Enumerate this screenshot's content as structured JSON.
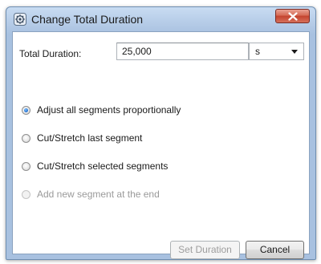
{
  "window": {
    "title": "Change Total Duration",
    "icon": "app-gear-icon"
  },
  "duration": {
    "label": "Total Duration:",
    "value": "25,000",
    "unit": "s"
  },
  "options": [
    {
      "label": "Adjust all segments proportionally",
      "checked": true,
      "disabled": false
    },
    {
      "label": "Cut/Stretch last segment",
      "checked": false,
      "disabled": false
    },
    {
      "label": "Cut/Stretch selected segments",
      "checked": false,
      "disabled": false
    },
    {
      "label": "Add new segment at the end",
      "checked": false,
      "disabled": true
    }
  ],
  "buttons": {
    "set_duration": "Set Duration",
    "cancel": "Cancel"
  },
  "colors": {
    "title_bar": "#b7cde8",
    "close_button": "#c4432e",
    "radio_selected": "#2b78d4"
  }
}
